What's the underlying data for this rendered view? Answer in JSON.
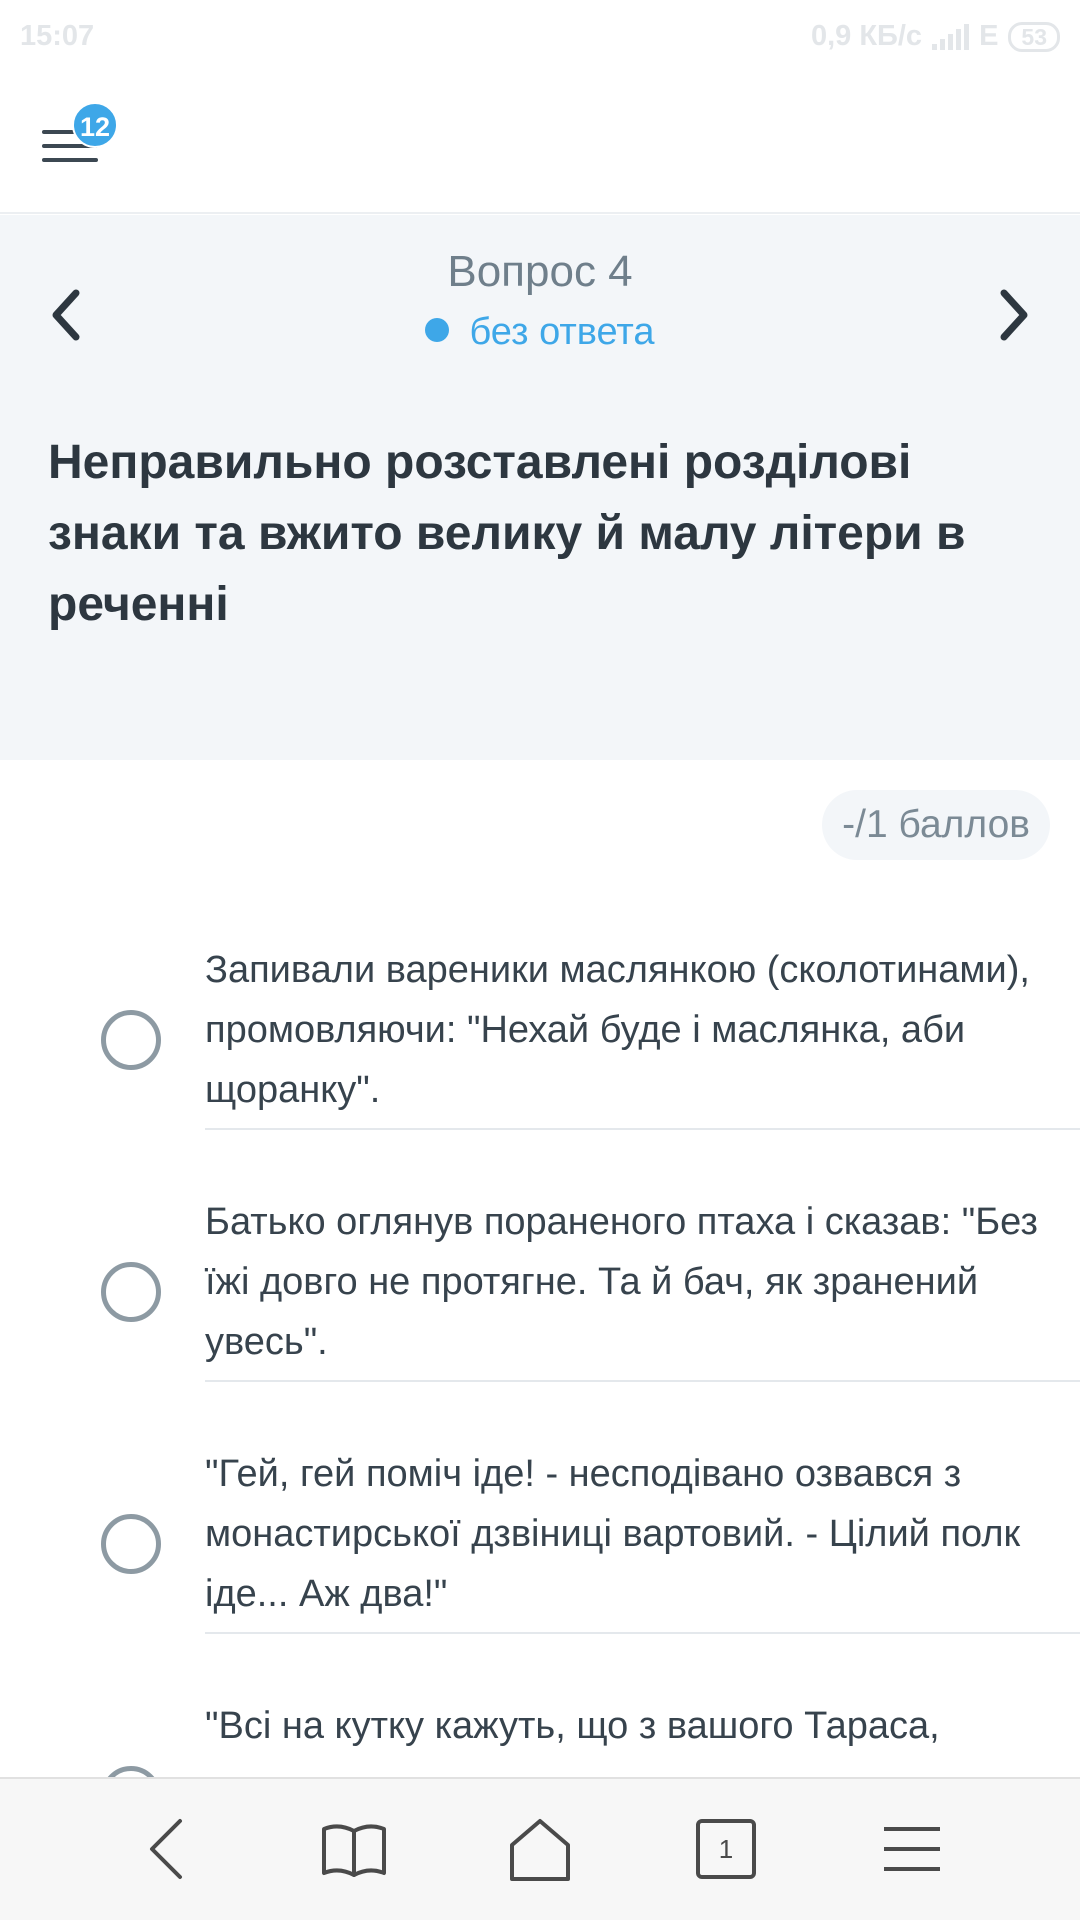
{
  "status": {
    "time": "15:07",
    "speed": "0,9 КБ/с",
    "network": "E",
    "battery": "53"
  },
  "header": {
    "menu_badge": "12",
    "menu_icon": "hamburger-menu-icon"
  },
  "question": {
    "number_label": "Вопрос 4",
    "status_label": "без ответа",
    "title": "Неправильно розставлені розділові знаки та вжито велику й малу літери в реченні",
    "score": "-/1 баллов"
  },
  "options": [
    {
      "text": "Запивали вареники маслянкою (сколотинами), промовляючи: \"Нехай буде і маслянка, аби щоранку\"."
    },
    {
      "text": "Батько оглянув пораненого птаха і сказав: \"Без їжі довго не протягне. Та й бач, як зранений увесь\"."
    },
    {
      "text": "\"Гей, гей поміч іде! - несподівано озвався з монастирської дзвіниці вартовий. - Цілий полк іде... Аж два!\""
    },
    {
      "text": "\"Всі на кутку кажуть, що з вашого Тараса,"
    }
  ],
  "browser": {
    "tabs_count": "1"
  },
  "colors": {
    "accent": "#3ea7e8",
    "header_bg": "#f3f6f9",
    "text": "#2d3740"
  }
}
